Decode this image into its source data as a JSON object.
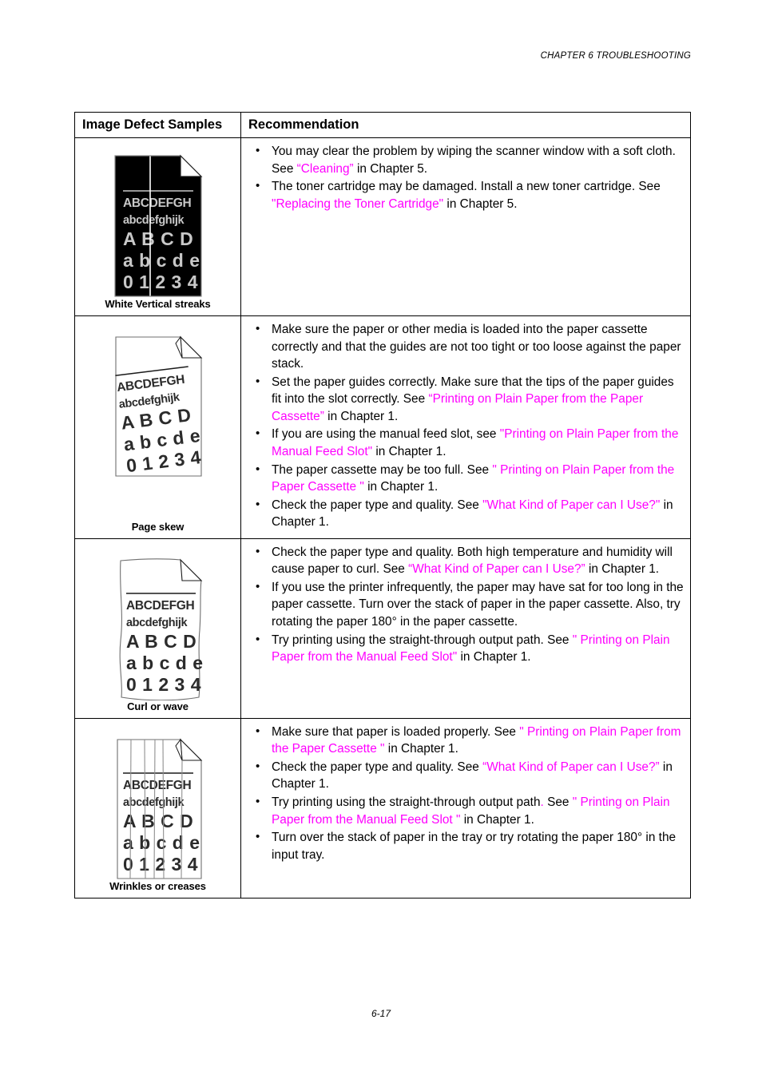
{
  "running_head": "CHAPTER 6 TROUBLESHOOTING",
  "footer": "6-17",
  "table": {
    "headers": {
      "sample": "Image Defect Samples",
      "recommendation": "Recommendation"
    },
    "sample_page_text": {
      "line1": "ABCDEFGH",
      "line2": "abcdefghijk",
      "line3": "A B C D",
      "line4": "a b c d e",
      "line5": "0 1 2 3 4"
    },
    "rows": [
      {
        "caption": "White Vertical streaks",
        "sample_kind": "inverted-page-with-white-streak",
        "bullets": [
          [
            {
              "t": "You may clear the problem by wiping the scanner window with a soft cloth.  See ",
              "link": false
            },
            {
              "t": "“Cleaning”",
              "link": true
            },
            {
              "t": " in Chapter 5.",
              "link": false
            }
          ],
          [
            {
              "t": "The toner cartridge may be damaged.  Install a new toner cartridge.  See ",
              "link": false
            },
            {
              "t": "\"Replacing the Toner Cartridge\"",
              "link": true
            },
            {
              "t": " in Chapter 5.",
              "link": false
            }
          ]
        ]
      },
      {
        "caption": "Page skew",
        "sample_kind": "skewed-page",
        "bullets": [
          [
            {
              "t": "Make sure the paper or other media is loaded into the paper cassette correctly and that the guides are not too tight or too loose against the paper stack.",
              "link": false
            }
          ],
          [
            {
              "t": "Set the paper guides correctly.  Make sure that the tips of the paper guides fit into the slot correctly.  See ",
              "link": false
            },
            {
              "t": "“Printing on Plain Paper from the Paper Cassette”",
              "link": true
            },
            {
              "t": " in Chapter 1.",
              "link": false
            }
          ],
          [
            {
              "t": "If you are using the manual feed slot, see ",
              "link": false
            },
            {
              "t": "\"Printing on Plain Paper from the Manual Feed Slot\"",
              "link": true
            },
            {
              "t": " in Chapter 1.",
              "link": false
            }
          ],
          [
            {
              "t": "The paper cassette may be too full.  See ",
              "link": false
            },
            {
              "t": "\" Printing on Plain Paper from the Paper Cassette \"",
              "link": true
            },
            {
              "t": " in Chapter 1.",
              "link": false
            }
          ],
          [
            {
              "t": "Check the paper type and quality.  See ",
              "link": false
            },
            {
              "t": "\"What Kind of Paper can I Use?\"",
              "link": true
            },
            {
              "t": " in Chapter 1.",
              "link": false
            }
          ]
        ]
      },
      {
        "caption": "Curl or wave",
        "sample_kind": "wavy-page",
        "bullets": [
          [
            {
              "t": "Check the paper type and quality.  Both high temperature and humidity will cause paper to curl.  See  ",
              "link": false
            },
            {
              "t": "“What Kind of Paper can I Use?”",
              "link": true
            },
            {
              "t": " in Chapter 1.",
              "link": false
            }
          ],
          [
            {
              "t": "If you use the printer infrequently, the paper may have sat for too long in the paper cassette.  Turn over the stack of paper in the paper cassette.  Also, try rotating the paper 180° in the paper cassette.",
              "link": false
            }
          ],
          [
            {
              "t": "Try printing using the straight-through output path.  See ",
              "link": false
            },
            {
              "t": "\" Printing on Plain Paper from the Manual Feed Slot\"",
              "link": true
            },
            {
              "t": " in Chapter 1.",
              "link": false
            }
          ]
        ]
      },
      {
        "caption": "Wrinkles or creases",
        "sample_kind": "creased-page",
        "bullets": [
          [
            {
              "t": "Make sure that paper is loaded properly.  See ",
              "link": false
            },
            {
              "t": "\" Printing on Plain Paper from the Paper Cassette \"",
              "link": true
            },
            {
              "t": " in Chapter 1.",
              "link": false
            }
          ],
          [
            {
              "t": "Check the paper type and quality.   See ",
              "link": false
            },
            {
              "t": "“What Kind of Paper can I Use?”",
              "link": true
            },
            {
              "t": " in Chapter 1.",
              "link": false
            }
          ],
          [
            {
              "t": "Try printing using the straight-through output path",
              "link": false
            },
            {
              "t": ".",
              "link": true
            },
            {
              "t": "  See ",
              "link": false
            },
            {
              "t": "\" Printing on Plain Paper from the Manual Feed Slot \"",
              "link": true
            },
            {
              "t": " in Chapter 1.",
              "link": false
            }
          ],
          [
            {
              "t": "Turn over the stack of paper in the tray or try rotating the paper 180° in the input tray.",
              "link": false
            }
          ]
        ]
      }
    ]
  },
  "colors": {
    "link": "#FF00FF",
    "text": "#000000",
    "rule": "#000000",
    "inverted_page_bg": "#000000",
    "inverted_page_text": "#C8C8C8"
  }
}
